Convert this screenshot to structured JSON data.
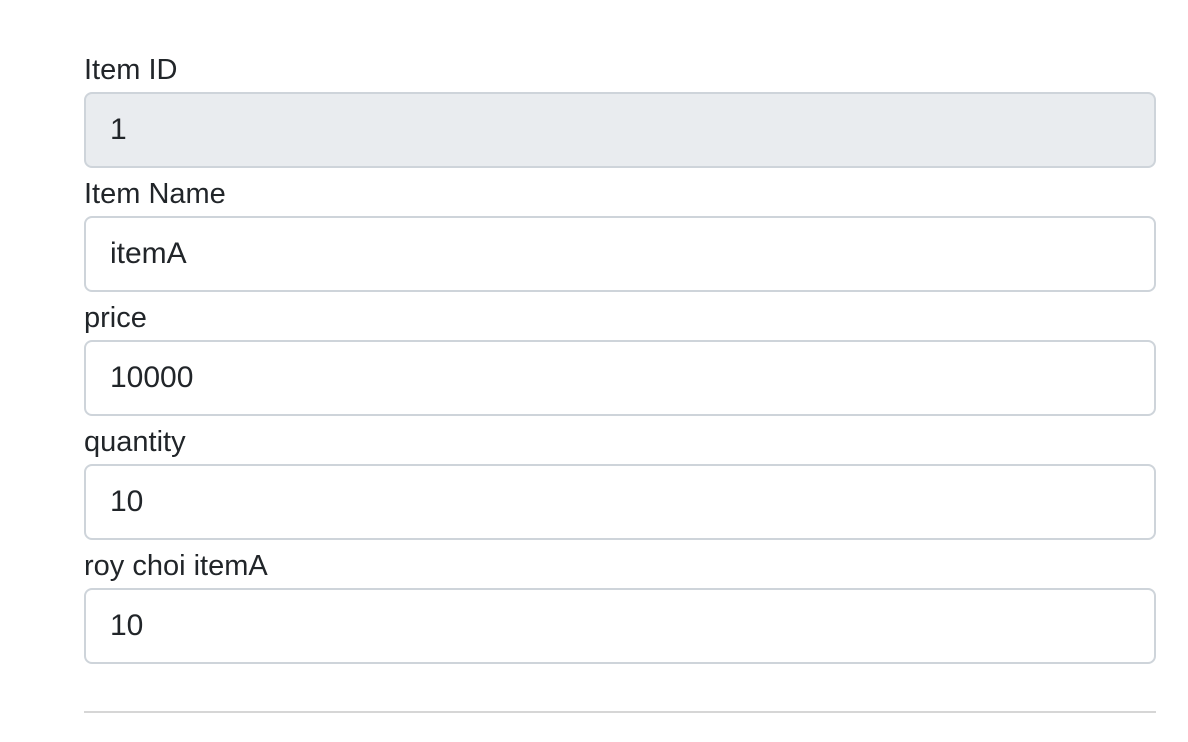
{
  "form": {
    "fields": [
      {
        "label": "Item ID",
        "value": "1",
        "readonly": true
      },
      {
        "label": "Item Name",
        "value": "itemA",
        "readonly": false
      },
      {
        "label": "price",
        "value": "10000",
        "readonly": false
      },
      {
        "label": "quantity",
        "value": "10",
        "readonly": false
      },
      {
        "label": "roy choi itemA",
        "value": "10",
        "readonly": false
      }
    ]
  },
  "colors": {
    "text": "#212529",
    "input_border": "#ced4da",
    "readonly_background": "#e9ecef",
    "divider": "#d6d6d6"
  }
}
